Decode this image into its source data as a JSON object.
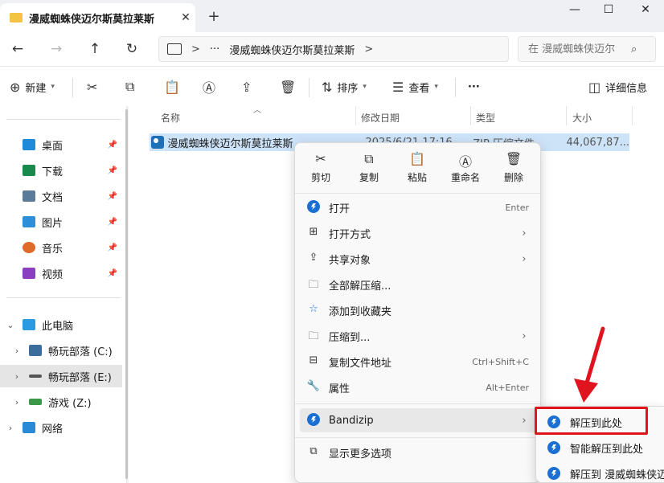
{
  "window": {
    "tab_title": "漫威蜘蛛侠迈尔斯莫拉莱斯",
    "tab_close": "✕",
    "new_tab": "+",
    "minimize": "—",
    "maximize": "☐",
    "close": "✕"
  },
  "address": {
    "sep": ">",
    "more": "···",
    "crumb": "漫威蜘蛛侠迈尔斯莫拉莱斯",
    "search_placeholder": "在 漫威蜘蛛侠迈尔"
  },
  "toolbar": {
    "new_label": "新建",
    "sort_label": "排序",
    "view_label": "查看",
    "more_label": "···",
    "details_label": "详细信息"
  },
  "sidebar": {
    "quick": [
      {
        "label": "桌面",
        "color": "#1f8ad8"
      },
      {
        "label": "下载",
        "color": "#178a4c"
      },
      {
        "label": "文档",
        "color": "#5a7a9a"
      },
      {
        "label": "图片",
        "color": "#2d8fd8"
      },
      {
        "label": "音乐",
        "color": "#e06a2a"
      },
      {
        "label": "视频",
        "color": "#8a3fc0"
      }
    ],
    "this_pc": "此电脑",
    "drives": [
      {
        "label": "畅玩部落 (C:)"
      },
      {
        "label": "畅玩部落 (E:)"
      },
      {
        "label": "游戏 (Z:)"
      }
    ],
    "network": "网络"
  },
  "columns": {
    "name": "名称",
    "date": "修改日期",
    "type": "类型",
    "size": "大小"
  },
  "file": {
    "name": "漫威蜘蛛侠迈尔斯莫拉莱斯",
    "date": "2025/6/21 17:16",
    "type": "ZIP 压缩文件",
    "size": "44,067,87..."
  },
  "context_menu": {
    "quick_actions": [
      {
        "label": "剪切",
        "icon": "scissors-icon"
      },
      {
        "label": "复制",
        "icon": "copy-icon"
      },
      {
        "label": "粘贴",
        "icon": "paste-icon"
      },
      {
        "label": "重命名",
        "icon": "rename-icon"
      },
      {
        "label": "删除",
        "icon": "trash-icon"
      }
    ],
    "items": [
      {
        "label": "打开",
        "shortcut": "Enter"
      },
      {
        "label": "打开方式",
        "shortcut": ""
      },
      {
        "label": "共享对象",
        "shortcut": ""
      },
      {
        "label": "全部解压缩...",
        "shortcut": ""
      },
      {
        "label": "添加到收藏夹",
        "shortcut": ""
      },
      {
        "label": "压缩到...",
        "shortcut": ""
      },
      {
        "label": "复制文件地址",
        "shortcut": "Ctrl+Shift+C"
      },
      {
        "label": "属性",
        "shortcut": "Alt+Enter"
      }
    ],
    "bandizip": "Bandizip",
    "more_options": "显示更多选项"
  },
  "submenu": {
    "items": [
      {
        "label": "解压到此处"
      },
      {
        "label": "智能解压到此处"
      },
      {
        "label": "解压到 漫威蜘蛛侠迈尔斯莫拉莱斯\\"
      }
    ]
  },
  "colors": {
    "accent": "#1a6fd4",
    "selection": "#cde3f8",
    "highlight_box": "#e0141e"
  }
}
